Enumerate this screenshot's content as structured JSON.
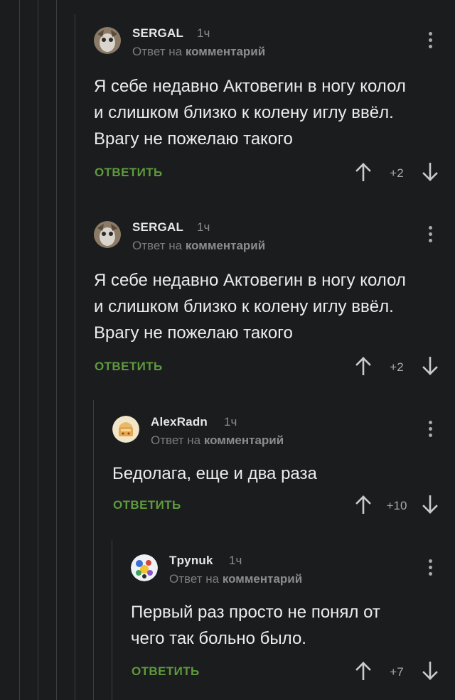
{
  "comments": [
    {
      "author": "SERGAL",
      "time": "1ч",
      "reply_prefix": "Ответ на",
      "reply_target": "комментарий",
      "lines": [
        "Я себе недавно Актовегин в ногу колол",
        "и слишком близко к колену иглу ввёл.",
        "Врагу не пожелаю такого"
      ],
      "reply_label": "ОТВЕТИТЬ",
      "rating": "+2"
    },
    {
      "author": "SERGAL",
      "time": "1ч",
      "reply_prefix": "Ответ на",
      "reply_target": "комментарий",
      "lines": [
        "Я себе недавно Актовегин в ногу колол",
        "и слишком близко к колену иглу ввёл.",
        "Врагу не пожелаю такого"
      ],
      "reply_label": "ОТВЕТИТЬ",
      "rating": "+2"
    },
    {
      "author": "AlexRadn",
      "time": "1ч",
      "reply_prefix": "Ответ на",
      "reply_target": "комментарий",
      "lines": [
        "Бедолага, еще и два раза"
      ],
      "reply_label": "ОТВЕТИТЬ",
      "rating": "+10"
    },
    {
      "author": "Tpynuk",
      "time": "1ч",
      "reply_prefix": "Ответ на",
      "reply_target": "комментарий",
      "lines": [
        "Первый раз просто не понял от",
        "чего так больно было."
      ],
      "reply_label": "ОТВЕТИТЬ",
      "rating": "+7"
    }
  ],
  "colors": {
    "background": "#1b1c1e",
    "reply_button": "#5e9a3d",
    "thread_line": "#3c3d40",
    "author": "#e6e6e6",
    "muted": "#8a8b8d"
  },
  "icons": {
    "upvote": "arrow-up-icon",
    "downvote": "arrow-down-icon",
    "menu": "more-vertical-icon"
  }
}
